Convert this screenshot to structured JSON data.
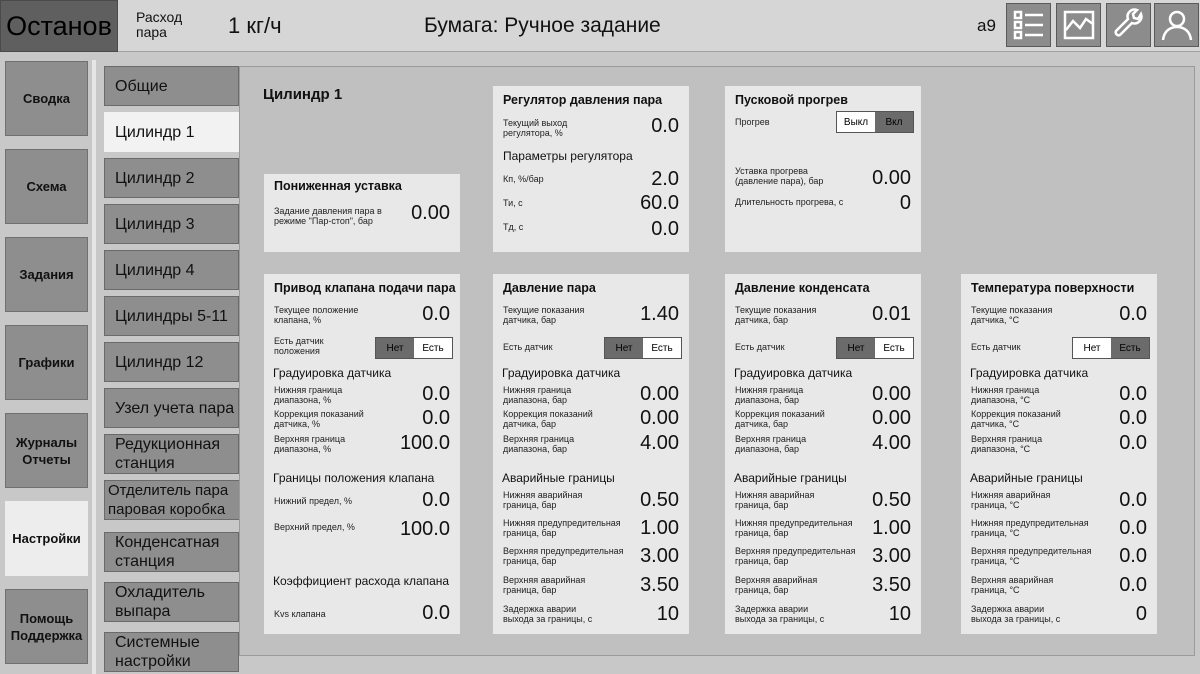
{
  "header": {
    "status": "Останов",
    "flow_label": "Расход пара",
    "flow_value": "1 кг/ч",
    "paper_mode": "Бумага: Ручное задание",
    "user_code": "a9",
    "icons": [
      "list-icon",
      "chart-icon",
      "wrench-icon",
      "user-icon"
    ]
  },
  "nav": {
    "items": [
      "Сводка",
      "Схема",
      "Задания",
      "Графики",
      "Журналы Отчеты",
      "Настройки",
      "Помощь Поддержка"
    ],
    "active": "Настройки"
  },
  "subtabs": {
    "items": [
      "Общие",
      "Цилиндр 1",
      "Цилиндр 2",
      "Цилиндр 3",
      "Цилиндр 4",
      "Цилиндры 5-11",
      "Цилиндр 12",
      "Узел учета пара",
      "Редукционная станция",
      "Отделитель пара паровая коробка",
      "Конденсатная станция",
      "Охладитель выпара",
      "Системные настройки"
    ],
    "active": "Цилиндр 1"
  },
  "page_title": "Цилиндр 1",
  "reduced": {
    "title": "Пониженная уставка",
    "label": "Задание давления пара в режиме \"Пар-стоп\", бар",
    "value": "0.00"
  },
  "regulator": {
    "title": "Регулятор давления пара",
    "out_label": "Текущий выход регулятора, %",
    "out_value": "0.0",
    "params_title": "Параметры регулятора",
    "kp_label": "Кп, %/бар",
    "kp_value": "2.0",
    "ti_label": "Ти, с",
    "ti_value": "60.0",
    "td_label": "Тд, с",
    "td_value": "0.0"
  },
  "warmup": {
    "title": "Пусковой прогрев",
    "toggle_label": "Прогрев",
    "toggle_off": "Выкл",
    "toggle_on": "Вкл",
    "setpoint_label": "Уставка прогрева (давление пара), бар",
    "setpoint_value": "0.00",
    "duration_label": "Длительность прогрева, с",
    "duration_value": "0"
  },
  "valve": {
    "title": "Привод клапана подачи пара",
    "pos_label": "Текущее положение клапана, %",
    "pos_value": "0.0",
    "sensor_label": "Есть датчик положения",
    "no": "Нет",
    "yes": "Есть",
    "cal_title": "Градуировка датчика",
    "low_label": "Нижняя граница диапазона, %",
    "low_value": "0.0",
    "corr_label": "Коррекция показаний датчика, %",
    "corr_value": "0.0",
    "high_label": "Верхняя граница диапазона, %",
    "high_value": "100.0",
    "limits_title": "Границы положения клапана",
    "min_label": "Нижний предел, %",
    "min_value": "0.0",
    "max_label": "Верхний предел, %",
    "max_value": "100.0",
    "kvs_title": "Коэффициент расхода клапана",
    "kvs_label": "Kvs клапана",
    "kvs_value": "0.0"
  },
  "steam": {
    "title": "Давление пара",
    "cur_label": "Текущие показания датчика, бар",
    "cur_value": "1.40",
    "sensor_label": "Есть датчик",
    "no": "Нет",
    "yes": "Есть",
    "cal_title": "Градуировка датчика",
    "low_label": "Нижняя граница диапазона, бар",
    "low_value": "0.00",
    "corr_label": "Коррекция показаний датчика, бар",
    "corr_value": "0.00",
    "high_label": "Верхняя граница диапазона, бар",
    "high_value": "4.00",
    "alarm_title": "Аварийные границы",
    "a1_label": "Нижняя аварийная граница, бар",
    "a1_value": "0.50",
    "a2_label": "Нижняя предупредительная граница, бар",
    "a2_value": "1.00",
    "a3_label": "Верхняя предупредительная граница, бар",
    "a3_value": "3.00",
    "a4_label": "Верхняя аварийная граница, бар",
    "a4_value": "3.50",
    "a5_label": "Задержка аварии выхода за границы, с",
    "a5_value": "10"
  },
  "condensate": {
    "title": "Давление конденсата",
    "cur_label": "Текущие показания датчика, бар",
    "cur_value": "0.01",
    "sensor_label": "Есть датчик",
    "no": "Нет",
    "yes": "Есть",
    "cal_title": "Градуировка датчика",
    "low_label": "Нижняя граница диапазона, бар",
    "low_value": "0.00",
    "corr_label": "Коррекция показаний датчика, бар",
    "corr_value": "0.00",
    "high_label": "Верхняя граница диапазона, бар",
    "high_value": "4.00",
    "alarm_title": "Аварийные границы",
    "a1_label": "Нижняя аварийная граница, бар",
    "a1_value": "0.50",
    "a2_label": "Нижняя предупредительная граница, бар",
    "a2_value": "1.00",
    "a3_label": "Верхняя предупредительная граница, бар",
    "a3_value": "3.00",
    "a4_label": "Верхняя аварийная граница, бар",
    "a4_value": "3.50",
    "a5_label": "Задержка аварии выхода за границы, с",
    "a5_value": "10"
  },
  "surface": {
    "title": "Температура поверхности",
    "cur_label": "Текущие показания датчика, °С",
    "cur_value": "0.0",
    "sensor_label": "Есть датчик",
    "no": "Нет",
    "yes": "Есть",
    "cal_title": "Градуировка датчика",
    "low_label": "Нижняя граница диапазона, °С",
    "low_value": "0.0",
    "corr_label": "Коррекция показаний датчика, °С",
    "corr_value": "0.0",
    "high_label": "Верхняя граница диапазона, °С",
    "high_value": "0.0",
    "alarm_title": "Аварийные границы",
    "a1_label": "Нижняя аварийная граница, °С",
    "a1_value": "0.0",
    "a2_label": "Нижняя предупредительная граница, °С",
    "a2_value": "0.0",
    "a3_label": "Верхняя предупредительная граница, °С",
    "a3_value": "0.0",
    "a4_label": "Верхняя аварийная граница, °С",
    "a4_value": "0.0",
    "a5_label": "Задержка аварии выхода за границы, с",
    "a5_value": "0"
  }
}
